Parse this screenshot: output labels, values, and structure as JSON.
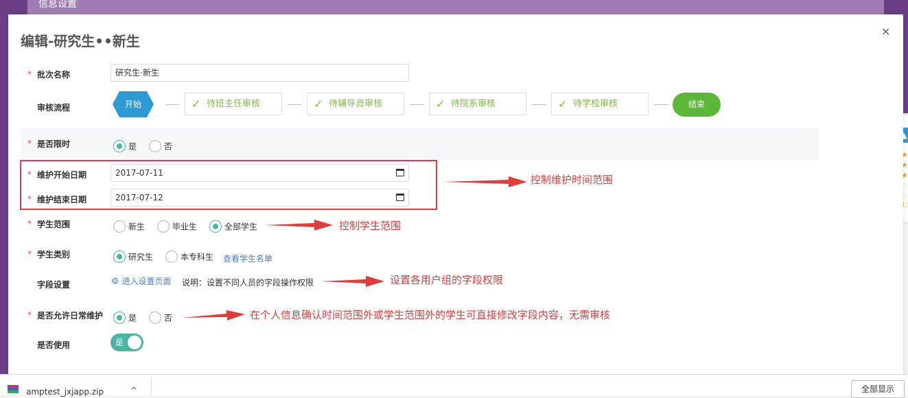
{
  "background": {
    "header_title": "信息设置",
    "rating": {
      "score": "3.5"
    }
  },
  "modal": {
    "title": "编辑-研究生••新生",
    "close_symbol": "×",
    "required_mark": "*",
    "fields": {
      "batch_name": {
        "label": "批次名称",
        "value": "研究生·新生"
      },
      "flow": {
        "label": "审核流程",
        "start": "开始",
        "steps": [
          "待班主任审核",
          "待辅导员审核",
          "待院系审核",
          "待学校审核"
        ],
        "end": "结束"
      },
      "time_limited": {
        "label": "是否限时",
        "options": [
          "是",
          "否"
        ],
        "selected": "是"
      },
      "start_date": {
        "label": "维护开始日期",
        "value": "2017-07-11"
      },
      "end_date": {
        "label": "维护结束日期",
        "value": "2017-07-12"
      },
      "student_scope": {
        "label": "学生范围",
        "options": [
          "新生",
          "毕业生",
          "全部学生"
        ],
        "selected": "全部学生"
      },
      "student_type": {
        "label": "学生类别",
        "options": [
          "研究生",
          "本专科生"
        ],
        "selected": "研究生",
        "link": "查看学生名单"
      },
      "field_settings": {
        "label": "字段设置",
        "link": "进入设置页面",
        "note": "说明：设置不同人员的字段操作权限"
      },
      "daily_maintenance": {
        "label": "是否允许日常维护",
        "options": [
          "是",
          "否"
        ],
        "selected": "是"
      },
      "in_use": {
        "label": "是否使用",
        "toggle_text": "是",
        "on": true
      }
    }
  },
  "annotations": {
    "time_range": "控制维护时间范围",
    "student_scope": "控制学生范围",
    "field_permission": "设置各用户组的字段权限",
    "daily_maintenance": "在个人信息确认时间范围外或学生范围外的学生可直接修改字段内容，无需审核"
  },
  "download_bar": {
    "file_name": "amptest_jxjapp.zip",
    "show_all": "全部显示"
  },
  "colors": {
    "accent": "#49b5a5",
    "flow_blue": "#2d9ad6",
    "flow_green": "#5cb637",
    "annotation_red": "#e23c3c"
  }
}
